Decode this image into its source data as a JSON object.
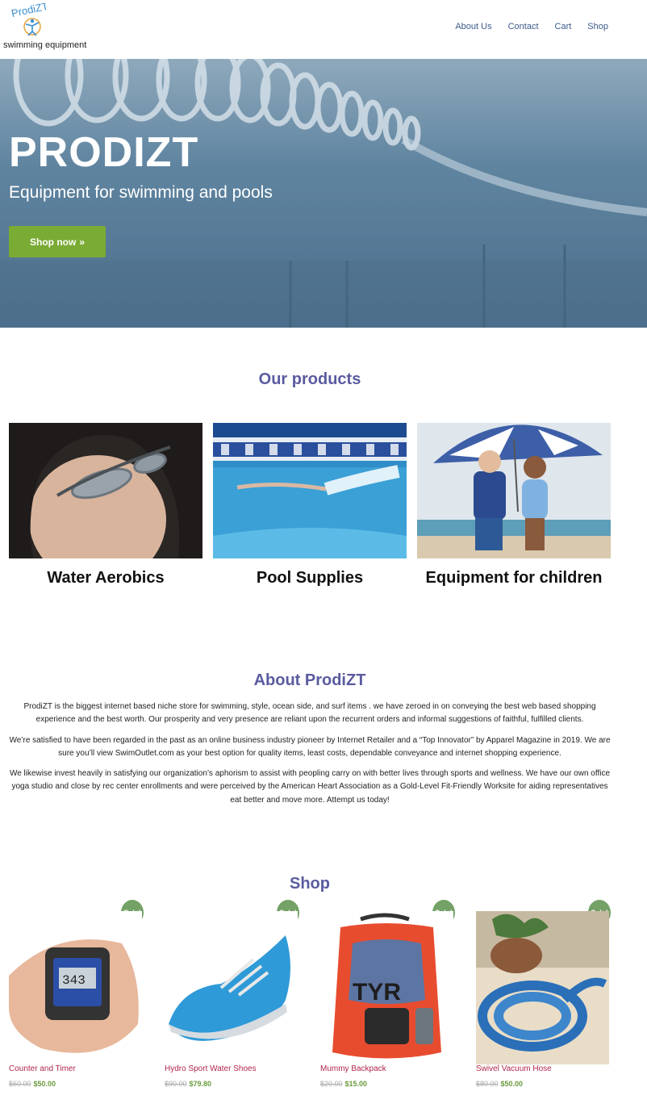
{
  "header": {
    "logo_word": "ProdiZT",
    "logo_tagline": "swimming equipment",
    "nav": [
      "About Us",
      "Contact",
      "Cart",
      "Shop"
    ]
  },
  "hero": {
    "title": "PRODIZT",
    "subtitle": "Equipment for swimming and pools",
    "button_label": "Shop now",
    "button_icon": "double-chevron-right-icon"
  },
  "products": {
    "heading": "Our products",
    "items": [
      {
        "name": "Water Aerobics"
      },
      {
        "name": "Pool Supplies"
      },
      {
        "name": "Equipment for children"
      }
    ]
  },
  "about": {
    "heading": "About ProdiZT",
    "paragraphs": [
      "ProdiZT is the biggest internet based niche store for swimming, style, ocean side, and surf items . we have zeroed in on conveying the best web based shopping experience and the best worth. Our prosperity and very presence are reliant upon the recurrent orders and informal suggestions of faithful, fulfilled clients.",
      "We’re satisfied to have been regarded in the past as an online business industry pioneer by Internet Retailer and a “Top Innovator” by Apparel Magazine in 2019. We are sure you’ll view SwimOutlet.com as your best option for quality items, least costs, dependable conveyance and internet shopping experience.",
      "We likewise invest heavily in satisfying our organization’s aphorism to assist with peopling carry on with better lives through sports and wellness. We have our own office yoga studio and close by rec center enrollments and were perceived by the American Heart Association as a Gold-Level Fit-Friendly Worksite for aiding representatives eat better and move more. Attempt us today!"
    ]
  },
  "shop": {
    "heading": "Shop",
    "sale_label": "Sale!",
    "items": [
      {
        "name": "Counter and Timer",
        "old_price": "$60.00",
        "price": "$50.00"
      },
      {
        "name": "Hydro Sport Water Shoes",
        "old_price": "$90.00",
        "price": "$79.80"
      },
      {
        "name": "Mummy Backpack",
        "old_price": "$20.00",
        "price": "$15.00"
      },
      {
        "name": "Swivel Vacuum Hose",
        "old_price": "$80.00",
        "price": "$50.00"
      }
    ]
  },
  "colors": {
    "accent_green": "#7aab34",
    "heading_purple": "#5a5b9f",
    "product_link": "#b1264b",
    "nav_link": "#3d5a8a"
  }
}
